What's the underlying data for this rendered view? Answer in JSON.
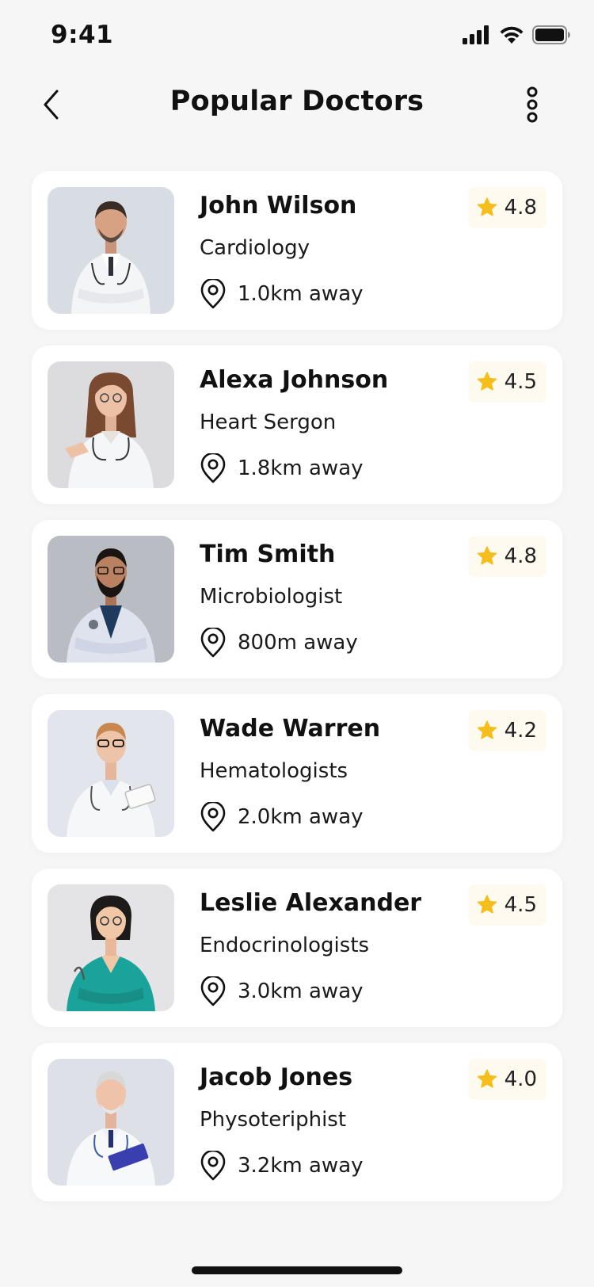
{
  "status_bar": {
    "time": "9:41"
  },
  "header": {
    "title": "Popular Doctors"
  },
  "colors": {
    "accent_star": "#F5BE1B",
    "card_bg": "#FFFFFF",
    "page_bg": "#F6F6F7",
    "rating_bg": "#FFFAF0"
  },
  "doctors": [
    {
      "name": "John Wilson",
      "specialty": "Cardiology",
      "distance": "1.0km away",
      "rating": "4.8"
    },
    {
      "name": "Alexa Johnson",
      "specialty": "Heart Sergon",
      "distance": "1.8km away",
      "rating": "4.5"
    },
    {
      "name": "Tim Smith",
      "specialty": "Microbiologist",
      "distance": "800m away",
      "rating": "4.8"
    },
    {
      "name": "Wade Warren",
      "specialty": "Hematologists",
      "distance": "2.0km away",
      "rating": "4.2"
    },
    {
      "name": "Leslie Alexander",
      "specialty": "Endocrinologists",
      "distance": "3.0km away",
      "rating": "4.5"
    },
    {
      "name": "Jacob Jones",
      "specialty": "Physoteriphist",
      "distance": "3.2km away",
      "rating": "4.0"
    }
  ]
}
